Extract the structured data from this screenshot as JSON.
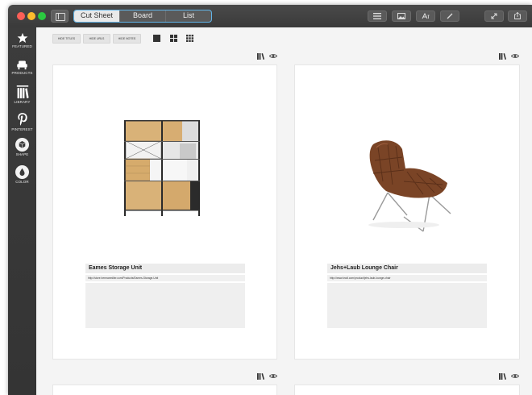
{
  "toolbar": {
    "tabs": [
      {
        "label": "Cut Sheet",
        "active": true
      },
      {
        "label": "Board",
        "active": false
      },
      {
        "label": "List",
        "active": false
      }
    ],
    "right_buttons": [
      "list-icon",
      "image-icon",
      "text-icon",
      "pencil-icon",
      "resize-icon",
      "share-icon"
    ]
  },
  "rail": {
    "items": [
      {
        "label": "FEATURED",
        "icon": "star-icon"
      },
      {
        "label": "PRODUCTS",
        "icon": "sofa-icon"
      },
      {
        "label": "LIBRARY",
        "icon": "books-icon"
      },
      {
        "label": "PINTEREST",
        "icon": "pinterest-icon"
      },
      {
        "label": "SHAPE",
        "icon": "cube-icon"
      },
      {
        "label": "COLOR",
        "icon": "droplet-icon"
      }
    ]
  },
  "options": {
    "hide_titles": "HIDE TITLES",
    "hide_urls": "HIDE URLS",
    "hide_notes": "HIDE NOTES"
  },
  "cards": [
    {
      "title": "Eames Storage Unit",
      "url": "http://store.hermanmiller.com/Products/Eames-Storage-Unit"
    },
    {
      "title": "Jehs+Laub Lounge Chair",
      "url": "http://www.knoll.com/product/jehs-laub-lounge-chair"
    }
  ],
  "colors": {
    "accent": "#62b6ea",
    "chrome": "#3f3f3f",
    "card_bg": "#ffffff",
    "chair_leather": "#7a4426"
  }
}
